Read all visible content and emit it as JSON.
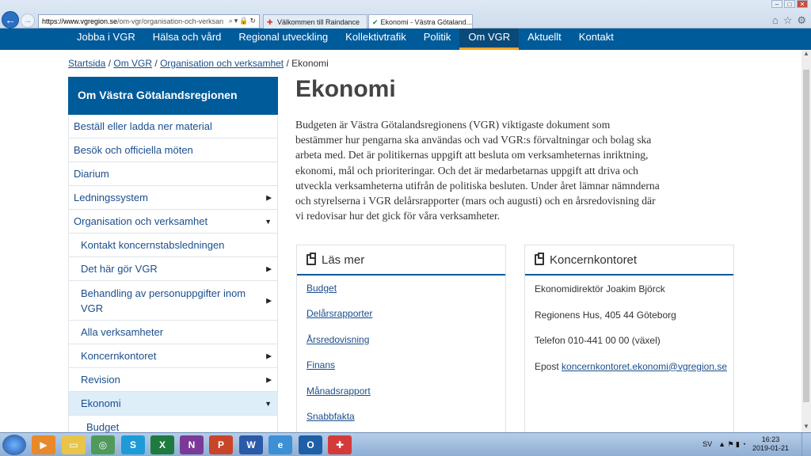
{
  "browser": {
    "url_domain": "https://www.vgregion.se",
    "url_rest": "/om-vgr/organisation-och-verksan",
    "tabs": [
      {
        "label": "Välkommen till Raindance",
        "close": ""
      },
      {
        "label": "Ekonomi - Västra Götaland...",
        "close": "×"
      }
    ]
  },
  "site_nav": [
    "Jobba i VGR",
    "Hälsa och vård",
    "Regional utveckling",
    "Kollektivtrafik",
    "Politik",
    "Om VGR",
    "Aktuellt",
    "Kontakt"
  ],
  "breadcrumb": {
    "items": [
      "Startsida",
      "Om VGR",
      "Organisation och verksamhet"
    ],
    "separator": " / ",
    "current": "Ekonomi"
  },
  "sidebar": {
    "title": "Om Västra Götalandsregionen",
    "items": [
      {
        "label": "Beställ eller ladda ner material"
      },
      {
        "label": "Besök och officiella möten"
      },
      {
        "label": "Diarium"
      },
      {
        "label": "Ledningssystem",
        "arrow": "▶"
      },
      {
        "label": "Organisation och verksamhet",
        "arrow": "▼"
      },
      {
        "label": "Kontakt koncernstabsledningen"
      },
      {
        "label": "Det här gör VGR",
        "arrow": "▶"
      },
      {
        "label": "Behandling av personuppgifter inom VGR",
        "arrow": "▶"
      },
      {
        "label": "Alla verksamheter"
      },
      {
        "label": "Koncernkontoret",
        "arrow": "▶"
      },
      {
        "label": "Revision",
        "arrow": "▶"
      },
      {
        "label": "Ekonomi",
        "arrow": "▼"
      },
      {
        "label": "Budget"
      }
    ]
  },
  "main": {
    "title": "Ekonomi",
    "intro": "Budgeten är Västra Götalandsregionens (VGR) viktigaste dokument som bestämmer hur pengarna ska användas och vad VGR:s förvaltningar och bolag ska arbeta med. Det är politikernas uppgift att besluta om verksamheternas inriktning, ekonomi, mål och prioriteringar. Och det är medarbetarnas uppgift att driva och utveckla verksamheterna utifrån de politiska besluten. Under året lämnar nämnderna och styrelserna i VGR delårsrapporter (mars och augusti) och en årsredovisning där vi redovisar hur det gick för våra verksamheter."
  },
  "read_more": {
    "title": "Läs mer",
    "links": [
      "Budget",
      "Delårsrapporter",
      "Årsredovisning",
      "Finans",
      "Månadsrapport",
      "Snabbfakta"
    ]
  },
  "office": {
    "title": "Koncernkontoret",
    "director": "Ekonomidirektör Joakim Björck",
    "address": "Regionens Hus, 405 44 Göteborg",
    "phone": "Telefon 010-441 00 00 (växel)",
    "email_label": "Epost",
    "email": "koncernkontoret.ekonomi@vgregion.se"
  },
  "taskbar": {
    "language": "SV",
    "time": "16:23",
    "date": "2019-01-21"
  }
}
